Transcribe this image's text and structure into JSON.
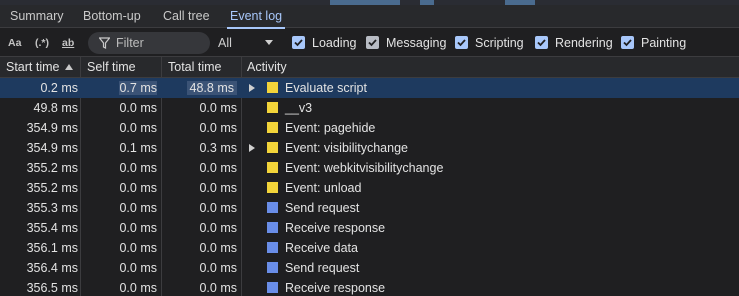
{
  "tabs": [
    {
      "label": "Summary",
      "active": false
    },
    {
      "label": "Bottom-up",
      "active": false
    },
    {
      "label": "Call tree",
      "active": false
    },
    {
      "label": "Event log",
      "active": true
    }
  ],
  "toolbar": {
    "match_case_label": "Aa",
    "regex_label": "(.*)",
    "whole_word_label": "ab",
    "filter_placeholder": "Filter",
    "duration_select": "All",
    "checkboxes": [
      {
        "label": "Loading",
        "checked": true
      },
      {
        "label": "Messaging",
        "checked": true
      },
      {
        "label": "Scripting",
        "checked": true
      },
      {
        "label": "Rendering",
        "checked": true
      },
      {
        "label": "Painting",
        "checked": true
      }
    ]
  },
  "columns": {
    "start": "Start time",
    "self": "Self time",
    "total": "Total time",
    "activity": "Activity"
  },
  "colors": {
    "scripting": "#f3d43a",
    "loading": "#6a8ee8",
    "selected_row": "#1e3a5f",
    "accent": "#a8c7fa"
  },
  "rows": [
    {
      "start": "0.2 ms",
      "self": "0.7 ms",
      "total": "48.8 ms",
      "activity": "Evaluate script",
      "category": "scripting",
      "expandable": true,
      "selected": true
    },
    {
      "start": "49.8 ms",
      "self": "0.0 ms",
      "total": "0.0 ms",
      "activity": "__v3",
      "category": "scripting",
      "expandable": false,
      "selected": false
    },
    {
      "start": "354.9 ms",
      "self": "0.0 ms",
      "total": "0.0 ms",
      "activity": "Event: pagehide",
      "category": "scripting",
      "expandable": false,
      "selected": false
    },
    {
      "start": "354.9 ms",
      "self": "0.1 ms",
      "total": "0.3 ms",
      "activity": "Event: visibilitychange",
      "category": "scripting",
      "expandable": true,
      "selected": false
    },
    {
      "start": "355.2 ms",
      "self": "0.0 ms",
      "total": "0.0 ms",
      "activity": "Event: webkitvisibilitychange",
      "category": "scripting",
      "expandable": false,
      "selected": false
    },
    {
      "start": "355.2 ms",
      "self": "0.0 ms",
      "total": "0.0 ms",
      "activity": "Event: unload",
      "category": "scripting",
      "expandable": false,
      "selected": false
    },
    {
      "start": "355.3 ms",
      "self": "0.0 ms",
      "total": "0.0 ms",
      "activity": "Send request",
      "category": "loading",
      "expandable": false,
      "selected": false
    },
    {
      "start": "355.4 ms",
      "self": "0.0 ms",
      "total": "0.0 ms",
      "activity": "Receive response",
      "category": "loading",
      "expandable": false,
      "selected": false
    },
    {
      "start": "356.1 ms",
      "self": "0.0 ms",
      "total": "0.0 ms",
      "activity": "Receive data",
      "category": "loading",
      "expandable": false,
      "selected": false
    },
    {
      "start": "356.4 ms",
      "self": "0.0 ms",
      "total": "0.0 ms",
      "activity": "Send request",
      "category": "loading",
      "expandable": false,
      "selected": false
    },
    {
      "start": "356.5 ms",
      "self": "0.0 ms",
      "total": "0.0 ms",
      "activity": "Receive response",
      "category": "loading",
      "expandable": false,
      "selected": false
    }
  ]
}
